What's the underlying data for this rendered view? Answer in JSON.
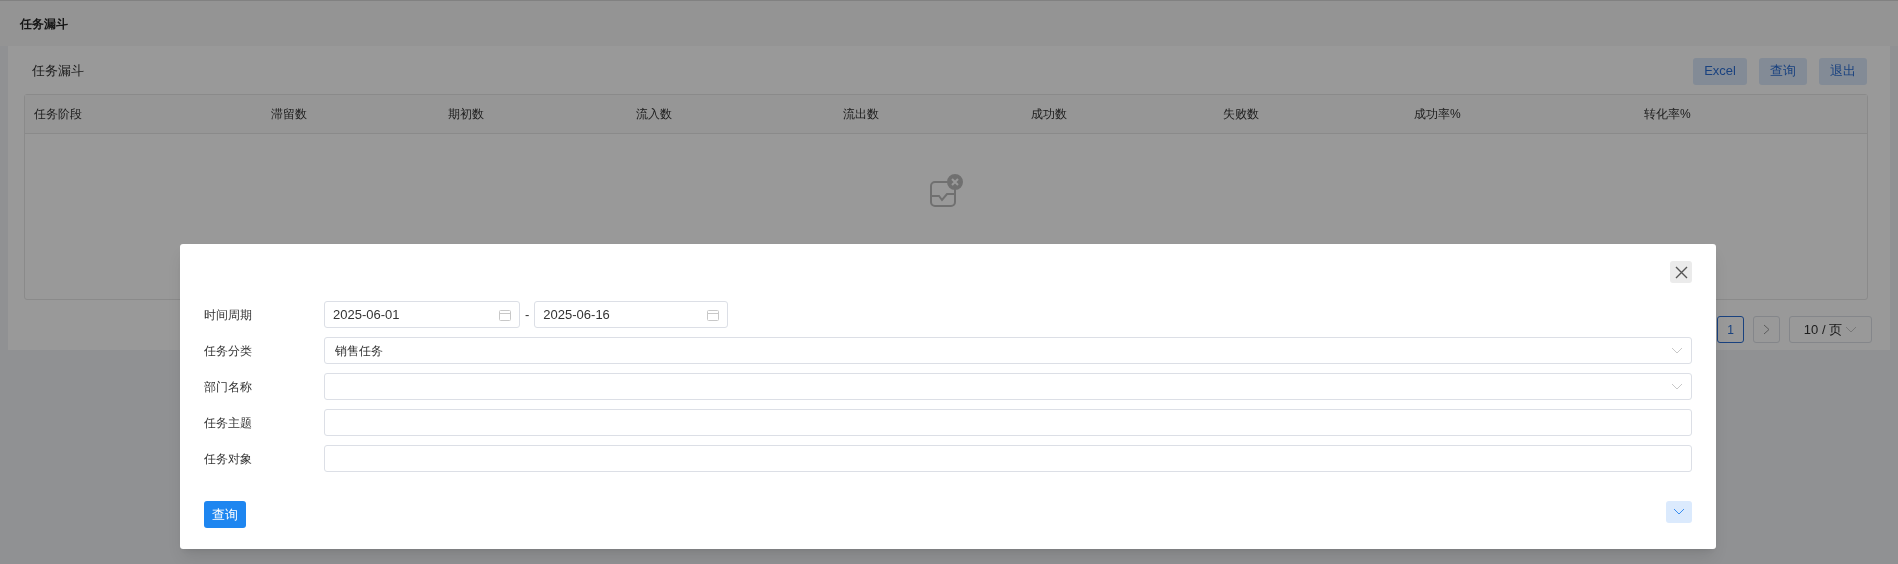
{
  "page_title": "任务漏斗",
  "card": {
    "title": "任务漏斗",
    "buttons": [
      "Excel",
      "查询",
      "退出"
    ],
    "table": {
      "columns": [
        "任务阶段",
        "滞留数",
        "期初数",
        "流入数",
        "流出数",
        "成功数",
        "失败数",
        "成功率%",
        "转化率%"
      ]
    }
  },
  "pagination": {
    "pages": [
      {
        "label": "1",
        "selected": true
      }
    ],
    "page_size": "10 / 页"
  },
  "dialog": {
    "fields": [
      {
        "kind": "daterange",
        "label": "时间周期",
        "start": "2025-06-01",
        "separator": "-",
        "end": "2025-06-16"
      },
      {
        "kind": "select",
        "label": "任务分类",
        "value": "销售任务"
      },
      {
        "kind": "select",
        "label": "部门名称"
      },
      {
        "kind": "text",
        "label": "任务主题"
      },
      {
        "kind": "text",
        "label": "任务对象"
      }
    ],
    "submit": "查询",
    "expanded": false
  }
}
